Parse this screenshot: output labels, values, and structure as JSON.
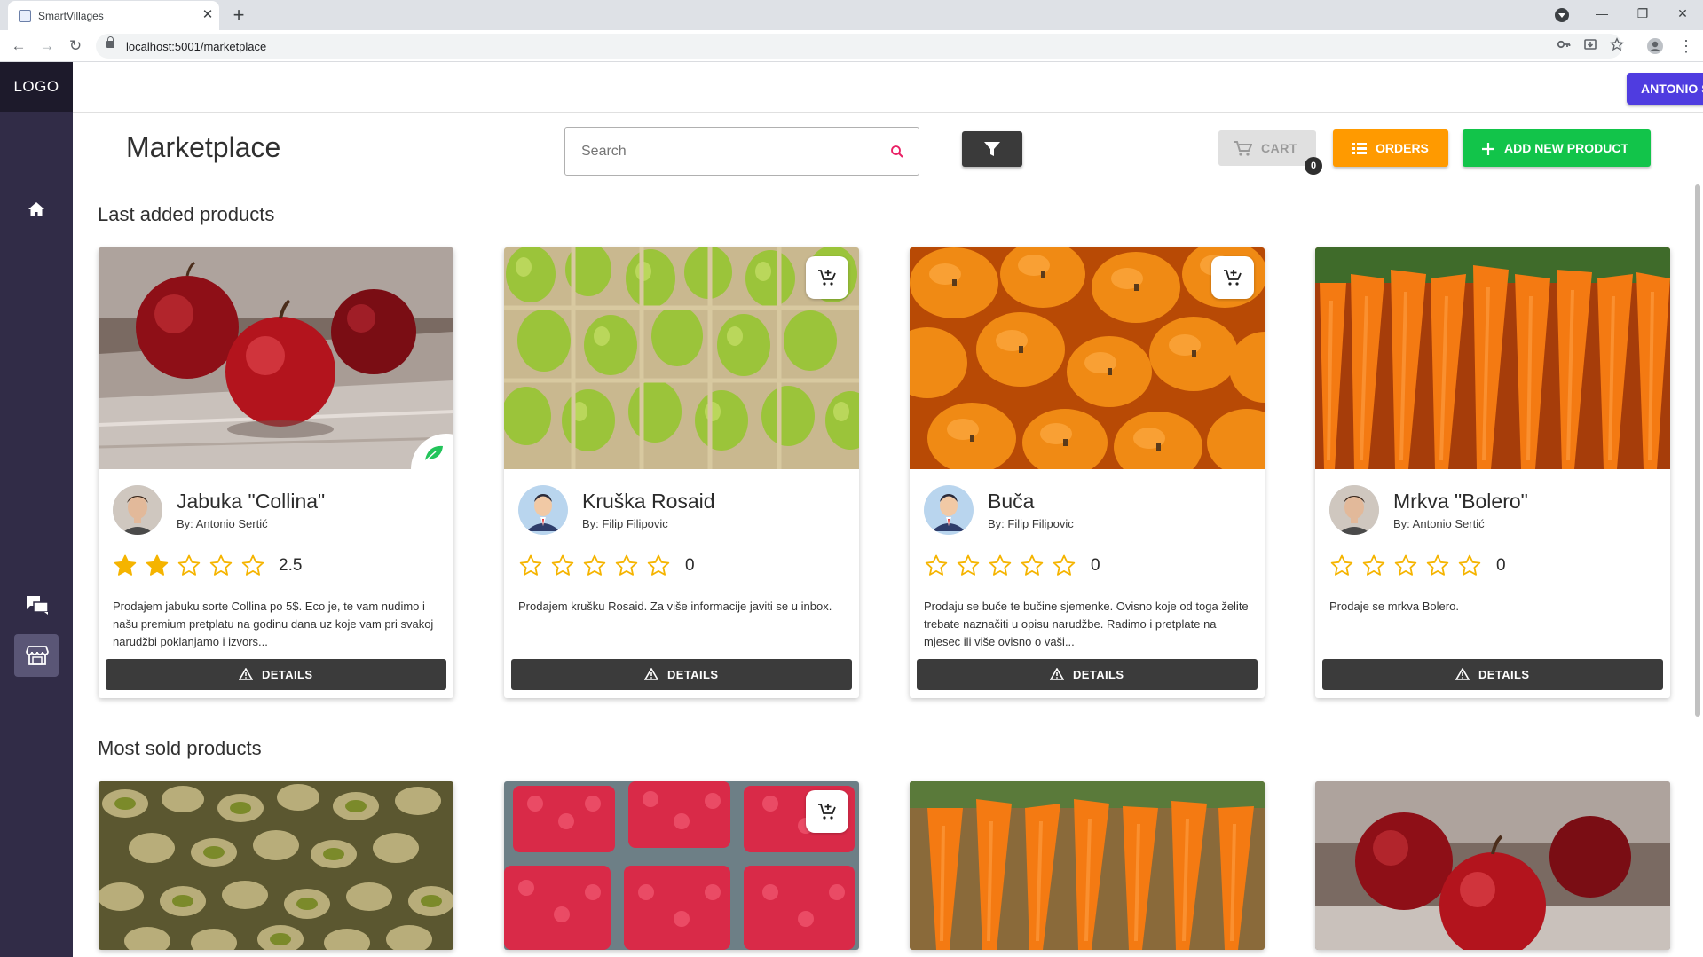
{
  "browser": {
    "tab_title": "SmartVillages",
    "url": "localhost:5001/marketplace",
    "close_glyph": "✕",
    "new_tab_glyph": "+",
    "minimize_glyph": "—",
    "maximize_glyph": "❐",
    "window_close_glyph": "✕",
    "back_glyph": "←",
    "forward_glyph": "→",
    "reload_glyph": "↻",
    "menu_glyph": "⋮"
  },
  "sidebar": {
    "logo": "LOGO",
    "items": [
      {
        "name": "home-icon",
        "active": false
      },
      {
        "name": "chat-icon",
        "active": false
      },
      {
        "name": "store-icon",
        "active": true
      }
    ],
    "bg_color": "#312c47"
  },
  "header": {
    "user_name": "ANTONIO SERTIĆ",
    "user_button_color": "#4f3ce0"
  },
  "main": {
    "title": "Marketplace",
    "search_placeholder": "Search",
    "cart_label": "CART",
    "cart_count": "0",
    "orders_label": "ORDERS",
    "add_label": "ADD NEW PRODUCT",
    "orders_color": "#ff9a00",
    "add_color": "#12c44a"
  },
  "sections": {
    "last_added": {
      "title": "Last added products",
      "products": [
        {
          "name": "Jabuka \"Collina\"",
          "author": "By: Antonio Sertić",
          "rating": "2.5",
          "rating_value": 2,
          "description": "Prodajem jabuku sorte Collina po 5$. Eco je, te vam nudimo i našu premium pretplatu na godinu dana uz koje vam pri svakoj narudžbi poklanjamo i izvors...",
          "details_label": "DETAILS",
          "image": "apples",
          "eco": true,
          "cart": false,
          "avatar": "photo"
        },
        {
          "name": "Kruška Rosaid",
          "author": "By: Filip Filipovic",
          "rating": "0",
          "rating_value": 0,
          "description": "Prodajem krušku Rosaid. Za više informacije javiti se u inbox.",
          "details_label": "DETAILS",
          "image": "pears",
          "eco": false,
          "cart": true,
          "avatar": "cartoon"
        },
        {
          "name": "Buča",
          "author": "By: Filip Filipovic",
          "rating": "0",
          "rating_value": 0,
          "description": "Prodaju se buče te bučine sjemenke. Ovisno koje od toga želite trebate naznačiti u opisu narudžbe. Radimo i pretplate na mjesec ili više ovisno o vaši...",
          "details_label": "DETAILS",
          "image": "pumpkins",
          "eco": false,
          "cart": true,
          "avatar": "cartoon"
        },
        {
          "name": "Mrkva \"Bolero\"",
          "author": "By: Antonio Sertić",
          "rating": "0",
          "rating_value": 0,
          "description": "Prodaje se mrkva Bolero.",
          "details_label": "DETAILS",
          "image": "carrots",
          "eco": false,
          "cart": false,
          "avatar": "photo"
        }
      ]
    },
    "most_sold": {
      "title": "Most sold products",
      "products": [
        {
          "image": "pistachios",
          "cart": false
        },
        {
          "image": "raspberries",
          "cart": true
        },
        {
          "image": "carrots",
          "cart": false
        },
        {
          "image": "apples",
          "cart": false
        }
      ]
    }
  }
}
